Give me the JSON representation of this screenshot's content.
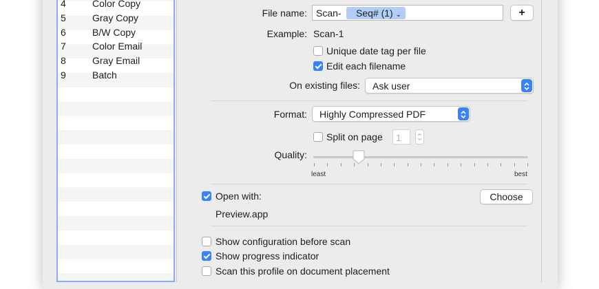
{
  "profiles": [
    {
      "num": "4",
      "name": "Color Copy"
    },
    {
      "num": "5",
      "name": "Gray Copy"
    },
    {
      "num": "6",
      "name": "B/W Copy"
    },
    {
      "num": "7",
      "name": "Color Email"
    },
    {
      "num": "8",
      "name": "Gray Email"
    },
    {
      "num": "9",
      "name": "Batch"
    }
  ],
  "file_name": {
    "label": "File name:",
    "prefix": "Scan-",
    "token": "Seq# (1)",
    "add_button": "+"
  },
  "example": {
    "label": "Example:",
    "value": "Scan-1"
  },
  "unique_date_tag": {
    "label": "Unique date tag per file",
    "checked": false
  },
  "edit_filename": {
    "label": "Edit each filename",
    "checked": true
  },
  "existing_files": {
    "label": "On existing files:",
    "value": "Ask user"
  },
  "format": {
    "label": "Format:",
    "value": "Highly Compressed PDF"
  },
  "split_on_page": {
    "label": "Split on page",
    "checked": false,
    "value": "1"
  },
  "quality": {
    "label": "Quality:",
    "min_label": "least",
    "max_label": "best",
    "level": 0.21
  },
  "open_with": {
    "label": "Open with:",
    "checked": true,
    "button": "Choose",
    "app": "Preview.app"
  },
  "show_config": {
    "label": "Show configuration before scan",
    "checked": false
  },
  "show_progress": {
    "label": "Show progress indicator",
    "checked": true
  },
  "scan_on_placement": {
    "label": "Scan this profile on document placement",
    "checked": false
  },
  "colors": {
    "accent": "#3a82f7",
    "list_border": "#8fa9f2",
    "token": "#b4cdf7"
  }
}
